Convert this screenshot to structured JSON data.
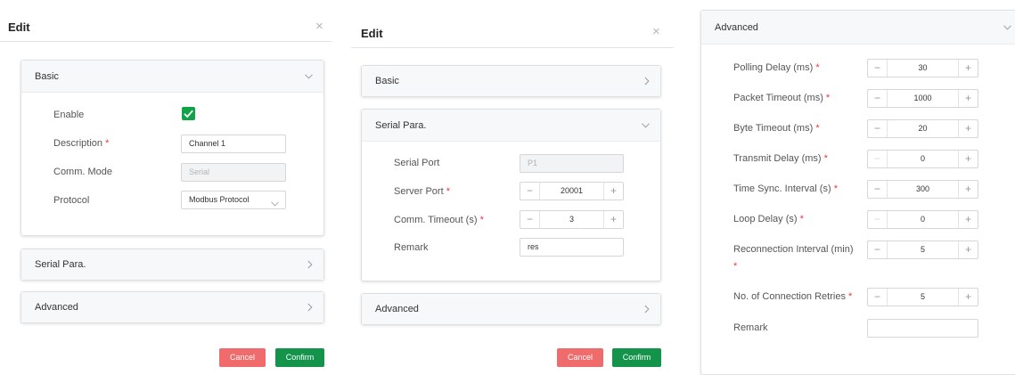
{
  "panel1": {
    "title": "Edit",
    "basic": {
      "title": "Basic",
      "enable_label": "Enable",
      "enabled": true,
      "description_label": "Description",
      "description_value": "Channel 1",
      "comm_mode_label": "Comm. Mode",
      "comm_mode_value": "Serial",
      "protocol_label": "Protocol",
      "protocol_value": "Modbus Protocol"
    },
    "serial_title": "Serial Para.",
    "advanced_title": "Advanced",
    "cancel_label": "Cancel",
    "confirm_label": "Confirm"
  },
  "panel2": {
    "title": "Edit",
    "basic_title": "Basic",
    "serial": {
      "title": "Serial Para.",
      "serial_port_label": "Serial Port",
      "serial_port_value": "P1",
      "server_port_label": "Server Port",
      "server_port_value": "20001",
      "comm_timeout_label": "Comm. Timeout (s)",
      "comm_timeout_value": "3",
      "remark_label": "Remark",
      "remark_value": "res"
    },
    "advanced_title": "Advanced",
    "cancel_label": "Cancel",
    "confirm_label": "Confirm"
  },
  "panel3": {
    "title": "Advanced",
    "fields": [
      {
        "label": "Polling Delay (ms)",
        "value": "30"
      },
      {
        "label": "Packet Timeout (ms)",
        "value": "1000"
      },
      {
        "label": "Byte Timeout (ms)",
        "value": "20"
      },
      {
        "label": "Transmit Delay (ms)",
        "value": "0"
      },
      {
        "label": "Time Sync. Interval (s)",
        "value": "300"
      },
      {
        "label": "Loop Delay (s)",
        "value": "0"
      },
      {
        "label": "Reconnection Interval (min)",
        "value": "5"
      },
      {
        "label": "No. of Connection Retries",
        "value": "5"
      }
    ],
    "remark_label": "Remark",
    "remark_value": ""
  },
  "required_mark": "*",
  "icons": {
    "close": "×",
    "minus": "−",
    "plus": "+"
  },
  "colors": {
    "confirm": "#13944a",
    "cancel": "#f06b6b",
    "checkbox": "#10a34a",
    "required": "#e03b3b"
  }
}
